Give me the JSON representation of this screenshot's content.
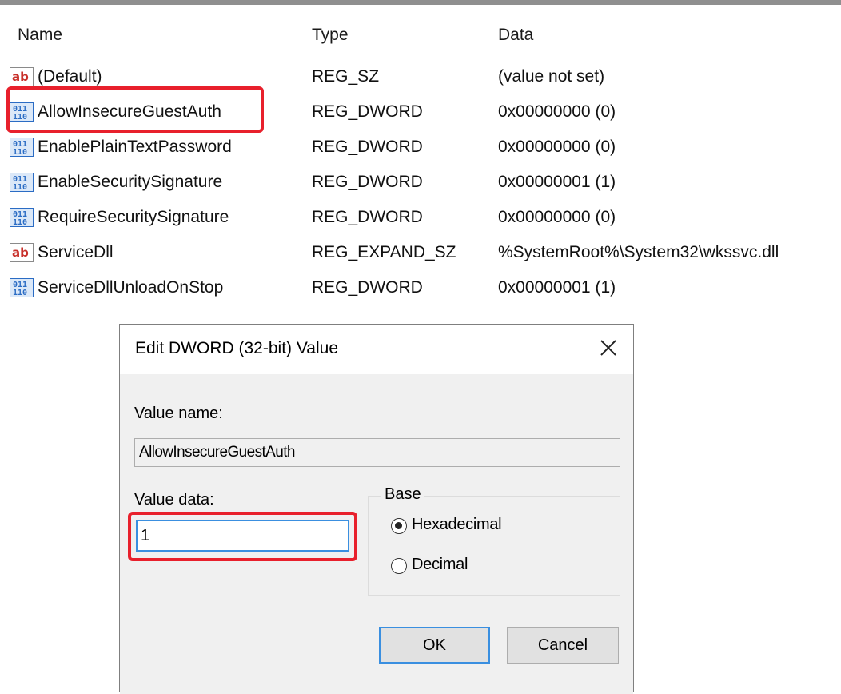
{
  "columns": {
    "name": "Name",
    "type": "Type",
    "data": "Data"
  },
  "rows": [
    {
      "icon": "string-value-icon",
      "name": "(Default)",
      "type": "REG_SZ",
      "data": "(value not set)"
    },
    {
      "icon": "binary-value-icon",
      "name": "AllowInsecureGuestAuth",
      "type": "REG_DWORD",
      "data": "0x00000000 (0)"
    },
    {
      "icon": "binary-value-icon",
      "name": "EnablePlainTextPassword",
      "type": "REG_DWORD",
      "data": "0x00000000 (0)"
    },
    {
      "icon": "binary-value-icon",
      "name": "EnableSecuritySignature",
      "type": "REG_DWORD",
      "data": "0x00000001 (1)"
    },
    {
      "icon": "binary-value-icon",
      "name": "RequireSecuritySignature",
      "type": "REG_DWORD",
      "data": "0x00000000 (0)"
    },
    {
      "icon": "string-value-icon",
      "name": "ServiceDll",
      "type": "REG_EXPAND_SZ",
      "data": "%SystemRoot%\\System32\\wkssvc.dll"
    },
    {
      "icon": "binary-value-icon",
      "name": "ServiceDllUnloadOnStop",
      "type": "REG_DWORD",
      "data": "0x00000001 (1)"
    }
  ],
  "dialog": {
    "title": "Edit DWORD (32-bit) Value",
    "close_glyph": "×",
    "value_name_label": "Value name:",
    "value_name": "AllowInsecureGuestAuth",
    "value_data_label": "Value data:",
    "value_data": "1",
    "base_label": "Base",
    "base_options": [
      "Hexadecimal",
      "Decimal"
    ],
    "base_selected": "Hexadecimal",
    "ok_label": "OK",
    "cancel_label": "Cancel"
  },
  "colors": {
    "highlight": "#e8202c",
    "focus_border": "#3a8fe0",
    "dialog_body": "#f0f0f0",
    "string_icon": "#c8302a",
    "binary_icon": "#2b6cc4"
  }
}
